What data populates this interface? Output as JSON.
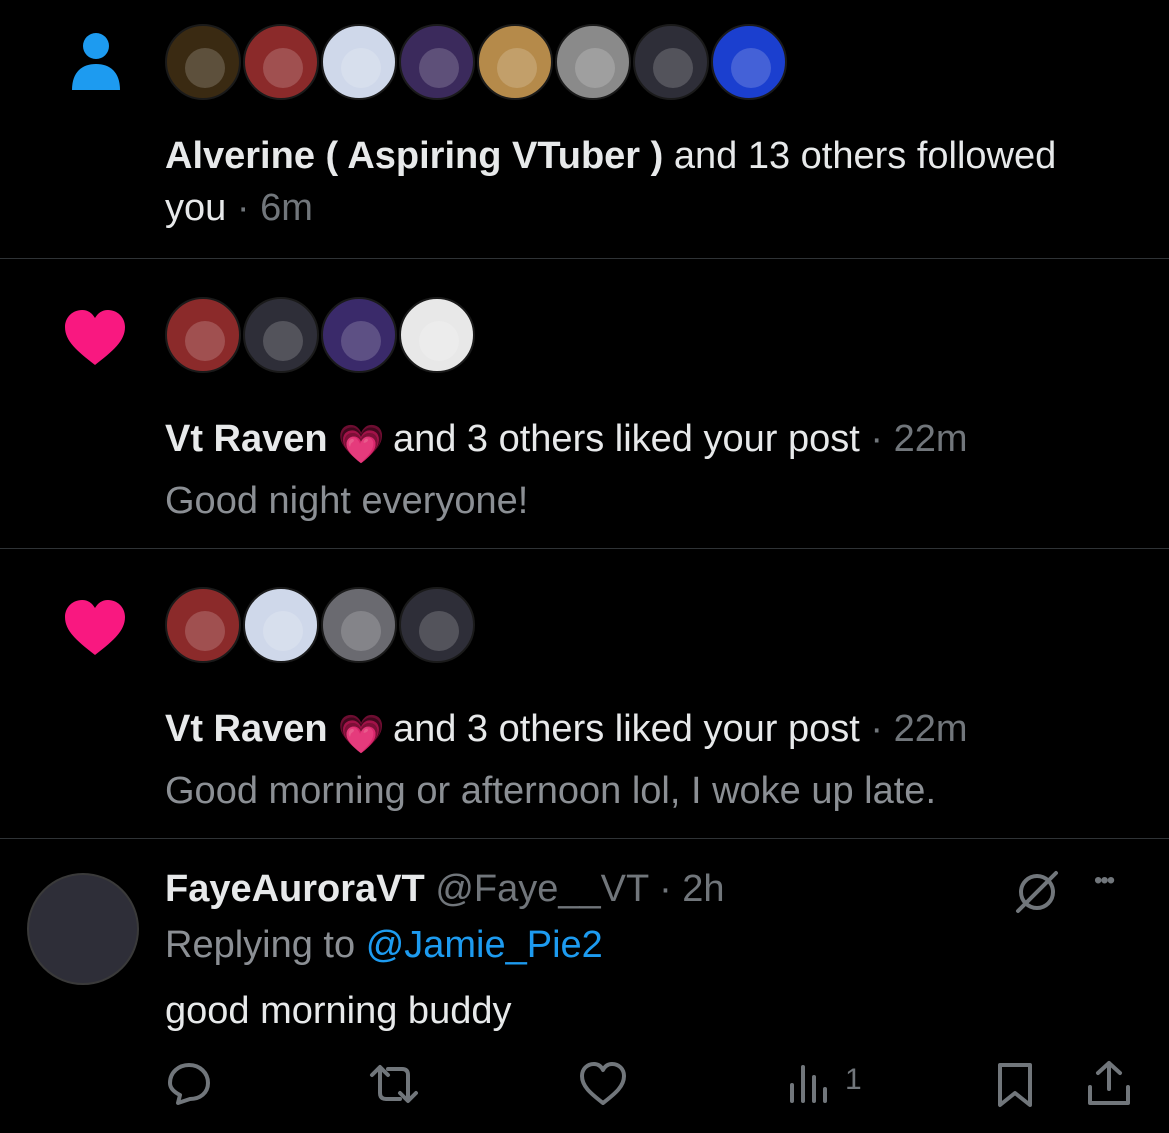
{
  "colors": {
    "background": "#000000",
    "text": "#e7e9ea",
    "muted": "#71767b",
    "link": "#1d9bf0",
    "follow_icon": "#1d9bf0",
    "like_icon": "#f91880",
    "divider": "#2f3336"
  },
  "notifications": [
    {
      "type": "follow",
      "icon": "person-icon",
      "avatar_colors": [
        "#3a2a12",
        "#8b2a2a",
        "#cfd8ea",
        "#3b2a5c",
        "#b58a4a",
        "#8a8a8a",
        "#2e2e38",
        "#1b3fcf"
      ],
      "actor": "Alverine ( Aspiring VTuber )",
      "action": "and 13 others followed",
      "action_cont": "you",
      "time": "6m"
    },
    {
      "type": "like",
      "icon": "heart-icon",
      "avatar_colors": [
        "#8b2a2a",
        "#2e2e38",
        "#3a2a6a",
        "#e8e8e8"
      ],
      "actor": "Vt Raven",
      "emoji": "💗",
      "action": "and 3 others liked your post",
      "time": "22m",
      "post_text": "Good night everyone!"
    },
    {
      "type": "like",
      "icon": "heart-icon",
      "avatar_colors": [
        "#8b2a2a",
        "#cfd8ea",
        "#6a6a70",
        "#2e2e38"
      ],
      "actor": "Vt Raven",
      "emoji": "💗",
      "action": "and 3 others liked your post",
      "time": "22m",
      "post_text": "Good morning or afternoon lol, I woke up late."
    },
    {
      "type": "reply",
      "display_name": "FayeAuroraVT",
      "handle": "@Faye__VT",
      "time": "2h",
      "replying_prefix": "Replying to",
      "replying_to": "@Jamie_Pie2",
      "text": "good morning buddy",
      "views": "1",
      "more": "•••"
    }
  ]
}
